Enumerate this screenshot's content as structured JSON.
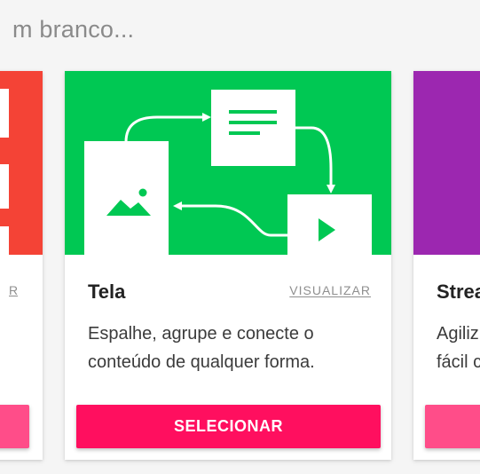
{
  "header": {
    "partial_text": "m branco..."
  },
  "cards": {
    "left": {
      "partial_link": "R"
    },
    "center": {
      "title": "Tela",
      "preview_label": "VISUALIZAR",
      "description": "Espalhe, agrupe e conecte o conteúdo de qualquer forma.",
      "button_label": "SELECIONAR",
      "hero_color": "#00c853"
    },
    "right": {
      "partial_title": "Strea",
      "partial_description_line1": "Agiliz",
      "partial_description_line2": "fácil c",
      "hero_color": "#9c27b0"
    }
  }
}
